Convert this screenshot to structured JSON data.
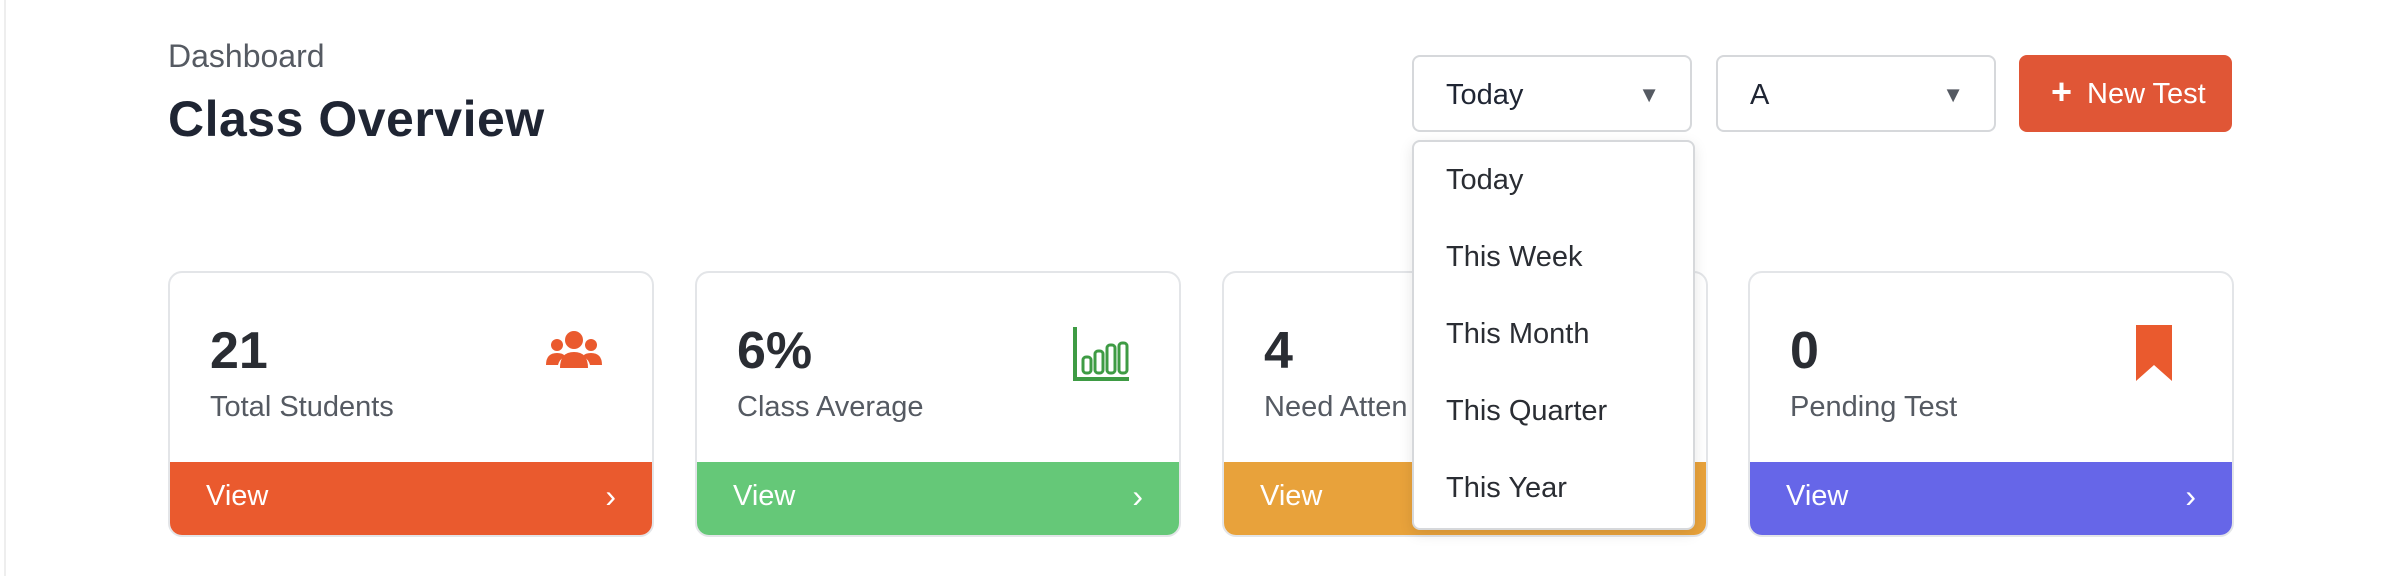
{
  "header": {
    "breadcrumb": "Dashboard",
    "title": "Class Overview"
  },
  "filters": {
    "period": {
      "selected": "Today",
      "options": [
        "Today",
        "This Week",
        "This Month",
        "This Quarter",
        "This Year"
      ]
    },
    "section": {
      "selected": "A"
    }
  },
  "actions": {
    "new_test_plus": "+",
    "new_test_label": "New Test"
  },
  "colors": {
    "accent": "#e05636",
    "red": "#ea5a2e",
    "green": "#65c878",
    "orange": "#e8a23b",
    "blue": "#6666e8",
    "chart_green": "#3e9b44"
  },
  "cards": [
    {
      "value": "21",
      "caption": "Total Students",
      "footer": "View",
      "arrow": "›",
      "icon": "users-icon"
    },
    {
      "value": "6%",
      "caption": "Class Average",
      "footer": "View",
      "arrow": "›",
      "icon": "bar-chart-icon"
    },
    {
      "value": "4",
      "caption": "Need Atten",
      "footer": "View",
      "arrow": "›",
      "icon": ""
    },
    {
      "value": "0",
      "caption": "Pending Test",
      "footer": "View",
      "arrow": "›",
      "icon": "bookmark-icon"
    }
  ]
}
